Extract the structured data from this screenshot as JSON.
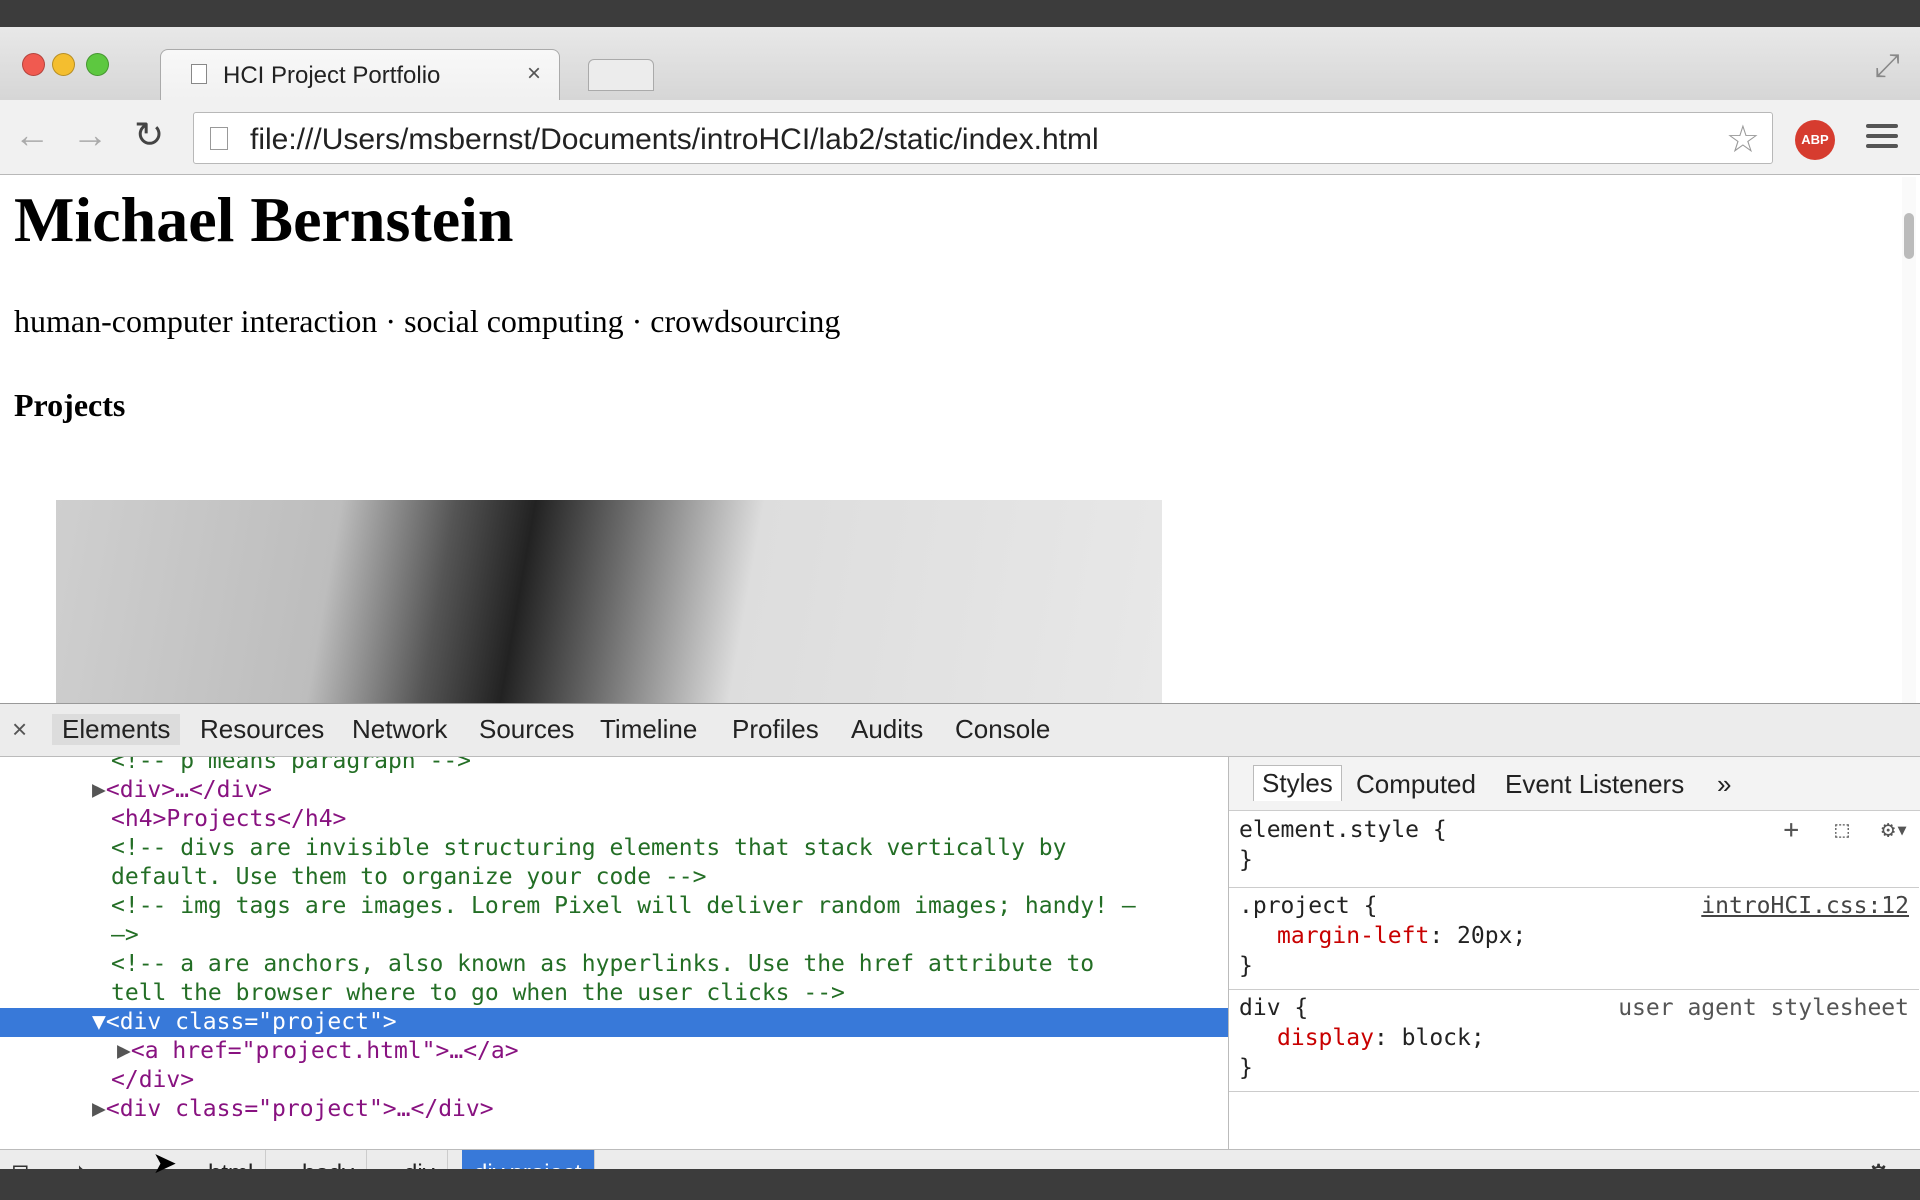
{
  "browser": {
    "tab_title": "HCI Project Portfolio",
    "tab_close": "×",
    "url": "file:///Users/msbernst/Documents/introHCI/lab2/static/index.html",
    "abp_label": "ABP"
  },
  "page": {
    "heading": "Michael Bernstein",
    "tagline": "human-computer interaction · social computing · crowdsourcing",
    "section_heading": "Projects"
  },
  "devtools": {
    "close": "×",
    "tabs": [
      "Elements",
      "Resources",
      "Network",
      "Sources",
      "Timeline",
      "Profiles",
      "Audits",
      "Console"
    ],
    "dom_lines": [
      "<!-- p means paragraph -->",
      "<div>…</div>",
      "<h4>Projects</h4>",
      "<!-- divs are invisible structuring elements that stack vertically by",
      "default. Use them to organize your code -->",
      "<!-- img tags are images. Lorem Pixel will deliver random images; handy! –",
      "–>",
      "<!-- a are anchors, also known as hyperlinks. Use the href attribute to",
      "tell the browser where to go when the user clicks -->",
      "<div class=\"project\">",
      "<a href=\"project.html\">…</a>",
      "</div>",
      "<div class=\"project\">…</div>"
    ],
    "styles_tabs": [
      "Styles",
      "Computed",
      "Event Listeners",
      "»"
    ],
    "rules": {
      "element_style": {
        "selector": "element.style {",
        "close": "}"
      },
      "project": {
        "selector": ".project {",
        "source": "introHCI.css:12",
        "prop": "margin-left",
        "value": "20px;",
        "close": "}"
      },
      "div": {
        "selector": "div {",
        "source": "user agent stylesheet",
        "prop": "display",
        "value": "block;",
        "close": "}"
      }
    },
    "breadcrumbs": [
      "html",
      "body",
      "div",
      "div.project"
    ]
  }
}
